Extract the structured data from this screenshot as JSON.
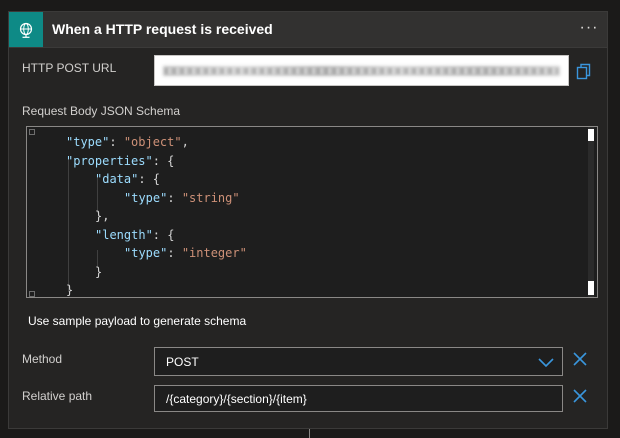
{
  "header": {
    "title": "When a HTTP request is received",
    "icon": "globe-request-icon",
    "accent_color": "#0e8a86",
    "more_label": "···"
  },
  "url_field": {
    "label": "HTTP POST URL",
    "copy_icon": "copy-icon"
  },
  "schema": {
    "label": "Request Body JSON Schema",
    "lines": [
      {
        "indent": 1,
        "tokens": [
          {
            "t": "key",
            "v": "\"type\""
          },
          {
            "t": "pun",
            "v": ": "
          },
          {
            "t": "str",
            "v": "\"object\""
          },
          {
            "t": "pun",
            "v": ","
          }
        ]
      },
      {
        "indent": 1,
        "tokens": [
          {
            "t": "key",
            "v": "\"properties\""
          },
          {
            "t": "pun",
            "v": ": {"
          }
        ]
      },
      {
        "indent": 2,
        "tokens": [
          {
            "t": "key",
            "v": "\"data\""
          },
          {
            "t": "pun",
            "v": ": {"
          }
        ]
      },
      {
        "indent": 3,
        "tokens": [
          {
            "t": "key",
            "v": "\"type\""
          },
          {
            "t": "pun",
            "v": ": "
          },
          {
            "t": "str",
            "v": "\"string\""
          }
        ]
      },
      {
        "indent": 2,
        "tokens": [
          {
            "t": "pun",
            "v": "},"
          }
        ]
      },
      {
        "indent": 2,
        "tokens": [
          {
            "t": "key",
            "v": "\"length\""
          },
          {
            "t": "pun",
            "v": ": {"
          }
        ]
      },
      {
        "indent": 3,
        "tokens": [
          {
            "t": "key",
            "v": "\"type\""
          },
          {
            "t": "pun",
            "v": ": "
          },
          {
            "t": "str",
            "v": "\"integer\""
          }
        ]
      },
      {
        "indent": 2,
        "tokens": [
          {
            "t": "pun",
            "v": "}"
          }
        ]
      },
      {
        "indent": 1,
        "tokens": [
          {
            "t": "pun",
            "v": "}"
          }
        ]
      }
    ]
  },
  "sample_payload_link": "Use sample payload to generate schema",
  "method": {
    "label": "Method",
    "value": "POST"
  },
  "relative_path": {
    "label": "Relative path",
    "value": "/{category}/{section}/{item}"
  },
  "colors": {
    "key": "#9cdcfe",
    "string": "#ce9178",
    "link_icon": "#3a96dd"
  }
}
